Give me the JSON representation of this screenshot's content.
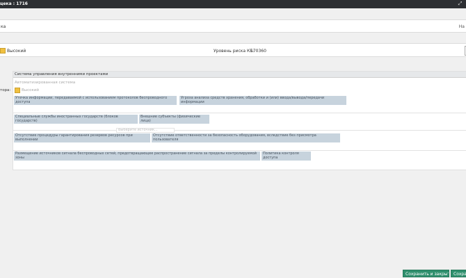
{
  "titlebar": {
    "title": "цека : 1716"
  },
  "name_row": {
    "label": "ка",
    "right_label": "На"
  },
  "risk_row": {
    "severity": "Высокий",
    "level_label": "Уровень риска КБ:",
    "level_value": "170360",
    "swatch_color": "#f0c040"
  },
  "main": {
    "side_label": "тора:",
    "system": "Система управления внутренними проектами",
    "system_type": "Автоматизированная система",
    "severity": "Высокий",
    "chips": [
      "Утечка информации, передаваемой с использованием протоколов беспроводного доступа",
      "Угроза анализа средств хранения, обработки и (или) ввода/вывода/передачи информации",
      "Специальные службы иностранных государств (блоков государств)",
      "Внешние субъекты (физические лица)",
      "Отсутствие процедуры гарантирования резервов ресурсов при выполнении",
      "Отсутствие ответственности за безопасность оборудования, вследствие без присмотра пользователя",
      "Размещение источников сигнала беспроводных сетей, предотвращающее распространение сигнала за пределы контролируемой зоны",
      "Политика контроля доступа"
    ],
    "ghost": "Выберите источник..."
  },
  "footer": {
    "save_close": "Сохранить и закрыть",
    "save": "Сохранить"
  }
}
